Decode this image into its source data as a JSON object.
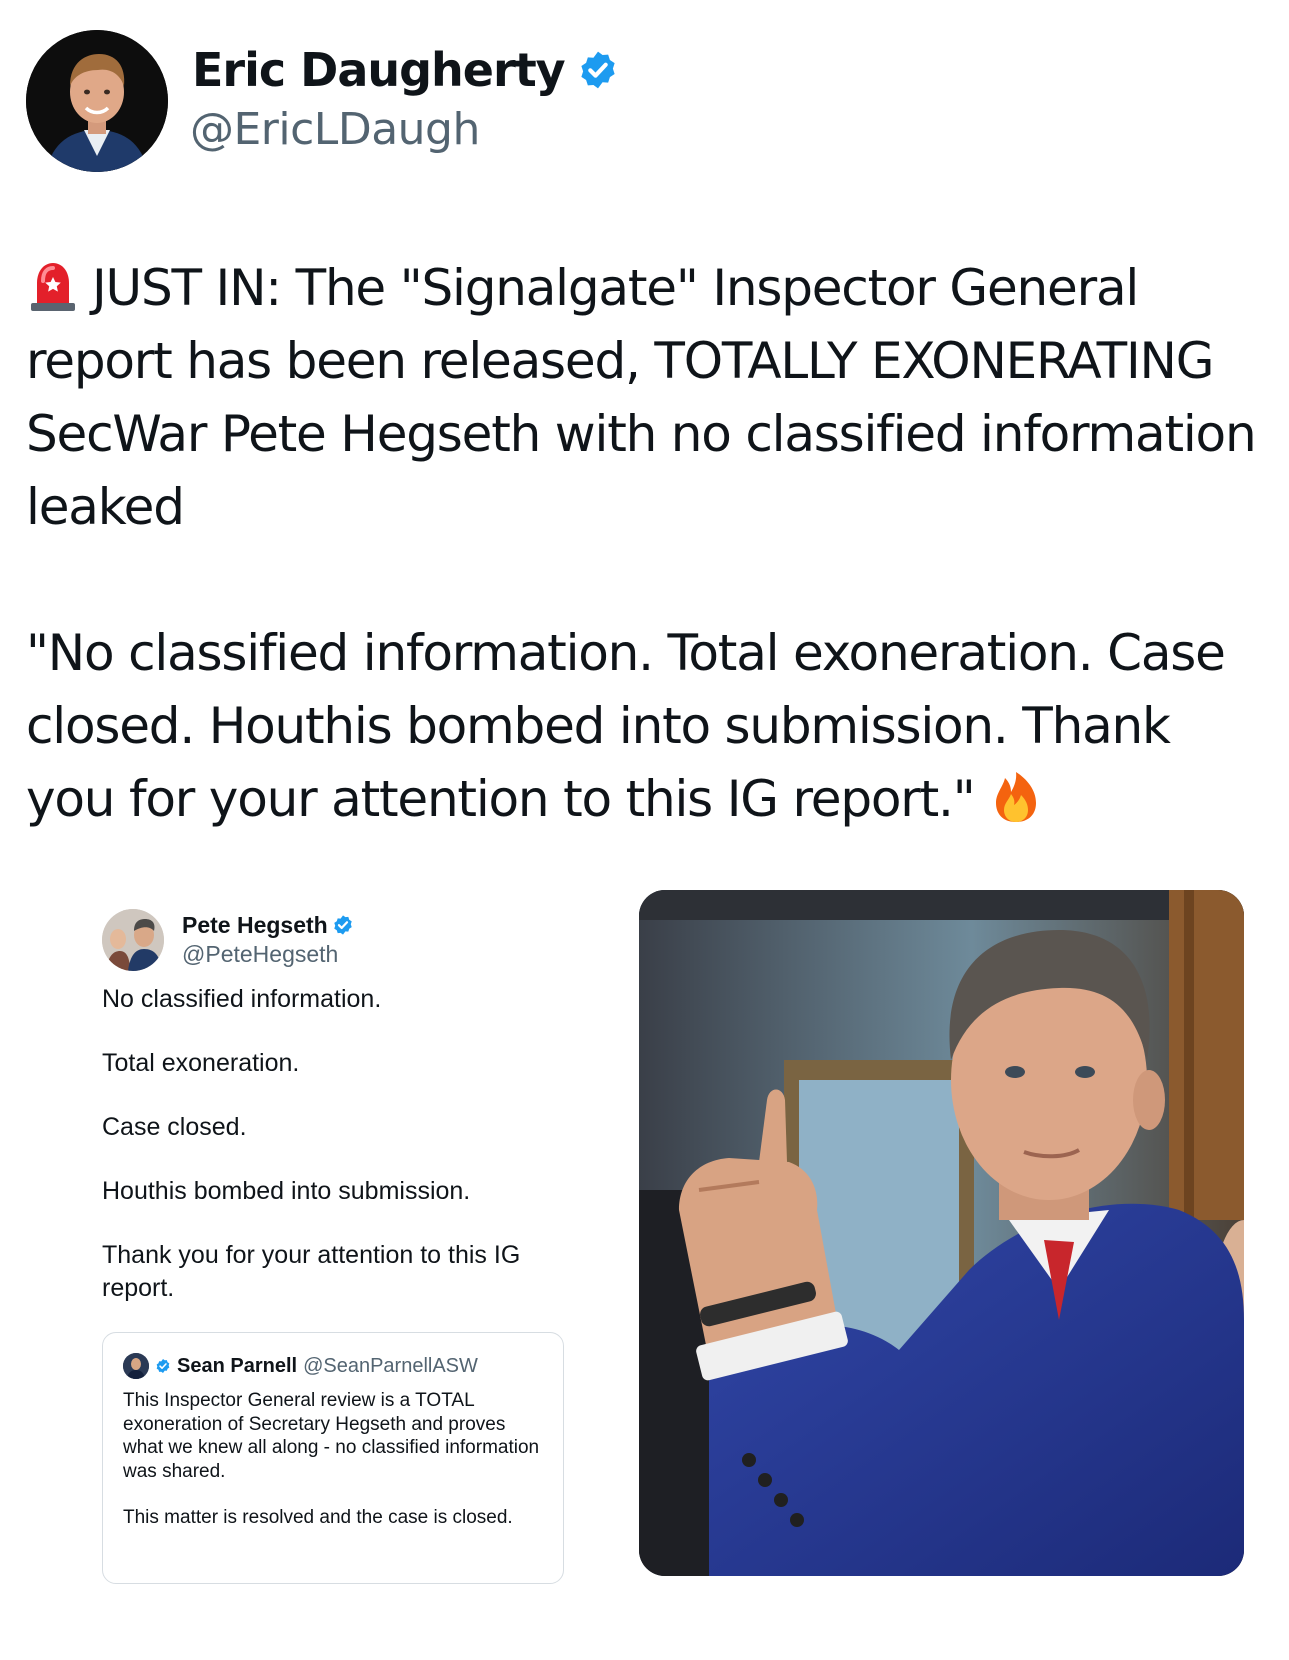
{
  "author": {
    "name": "Eric Daugherty",
    "handle": "@EricLDaugh",
    "verified": true
  },
  "tweet": {
    "paragraph_1": "JUST IN: The \"Signalgate\" Inspector General report has been released, TOTALLY EXONERATING SecWar Pete Hegseth with no classified information leaked",
    "paragraph_2": "\"No classified information. Total exoneration. Case closed. Houthis bombed into submission. Thank you for your attention to this IG report.\"",
    "leading_emoji": "siren-icon",
    "trailing_emoji": "fire-icon"
  },
  "quoted_post": {
    "author_name": "Pete Hegseth",
    "author_handle": "@PeteHegseth",
    "lines": [
      "No classified information.",
      "Total exoneration.",
      "Case closed.",
      "Houthis bombed into submission.",
      "Thank you for your attention to this IG report."
    ],
    "inner_quote": {
      "author_name": "Sean Parnell",
      "author_handle": "@SeanParnellASW",
      "paragraph_1": "This Inspector General review is a TOTAL exoneration of Secretary Hegseth and proves what we knew all along - no classified information was shared.",
      "paragraph_2": "This matter is resolved and the case is closed."
    }
  },
  "colors": {
    "text": "#0f1419",
    "secondary_text": "#536471",
    "verified_blue": "#1d9bf0",
    "card_border": "#d7dde2"
  }
}
